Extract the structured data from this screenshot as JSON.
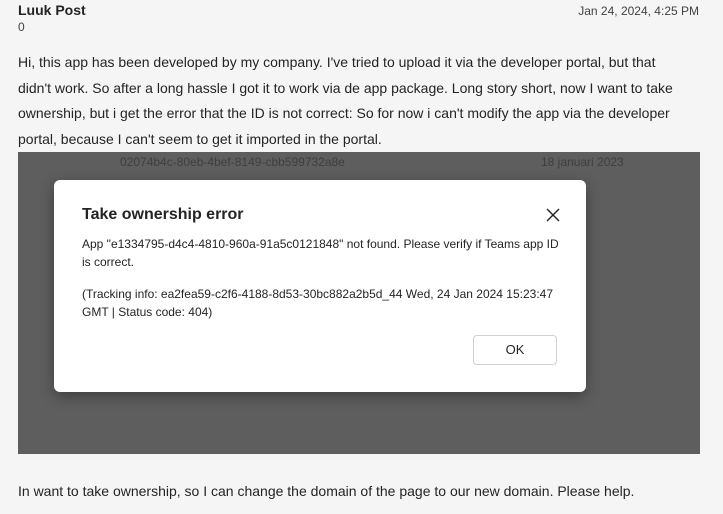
{
  "post": {
    "author": "Luuk Post",
    "kudos": "0",
    "date": "Jan 24, 2024, 4:25 PM",
    "body": "Hi, this app has been developed by my company. I've tried to upload it via the developer portal, but that didn't work. So after a long hassle I got it to work via de app package. Long story short, now I want to take ownership, but i get the error that the ID is not correct: So for now i can't modify the app via the developer portal, because I can't seem to get it imported in the portal.",
    "footer": "In want to take ownership, so I can change the domain of the page to our new domain. Please help."
  },
  "screenshot": {
    "background_row": {
      "id": "02074b4c-80eb-4bef-8149-cbb599732a8e",
      "date": "18 januari 2023"
    },
    "dialog": {
      "title": "Take ownership error",
      "message": "App \"e1334795-d4c4-4810-960a-91a5c0121848\" not found. Please verify if Teams app ID is correct.",
      "tracking": "(Tracking info: ea2fea59-c2f6-4188-8d53-30bc882a2b5d_44 Wed, 24 Jan 2024 15:23:47 GMT | Status code: 404)",
      "ok_label": "OK",
      "close_icon": "close-icon"
    }
  },
  "colors": {
    "page_bg": "#f5f5f5",
    "overlay_bg": "#5e5e5e",
    "dialog_bg": "#ffffff",
    "text": "#242424"
  }
}
